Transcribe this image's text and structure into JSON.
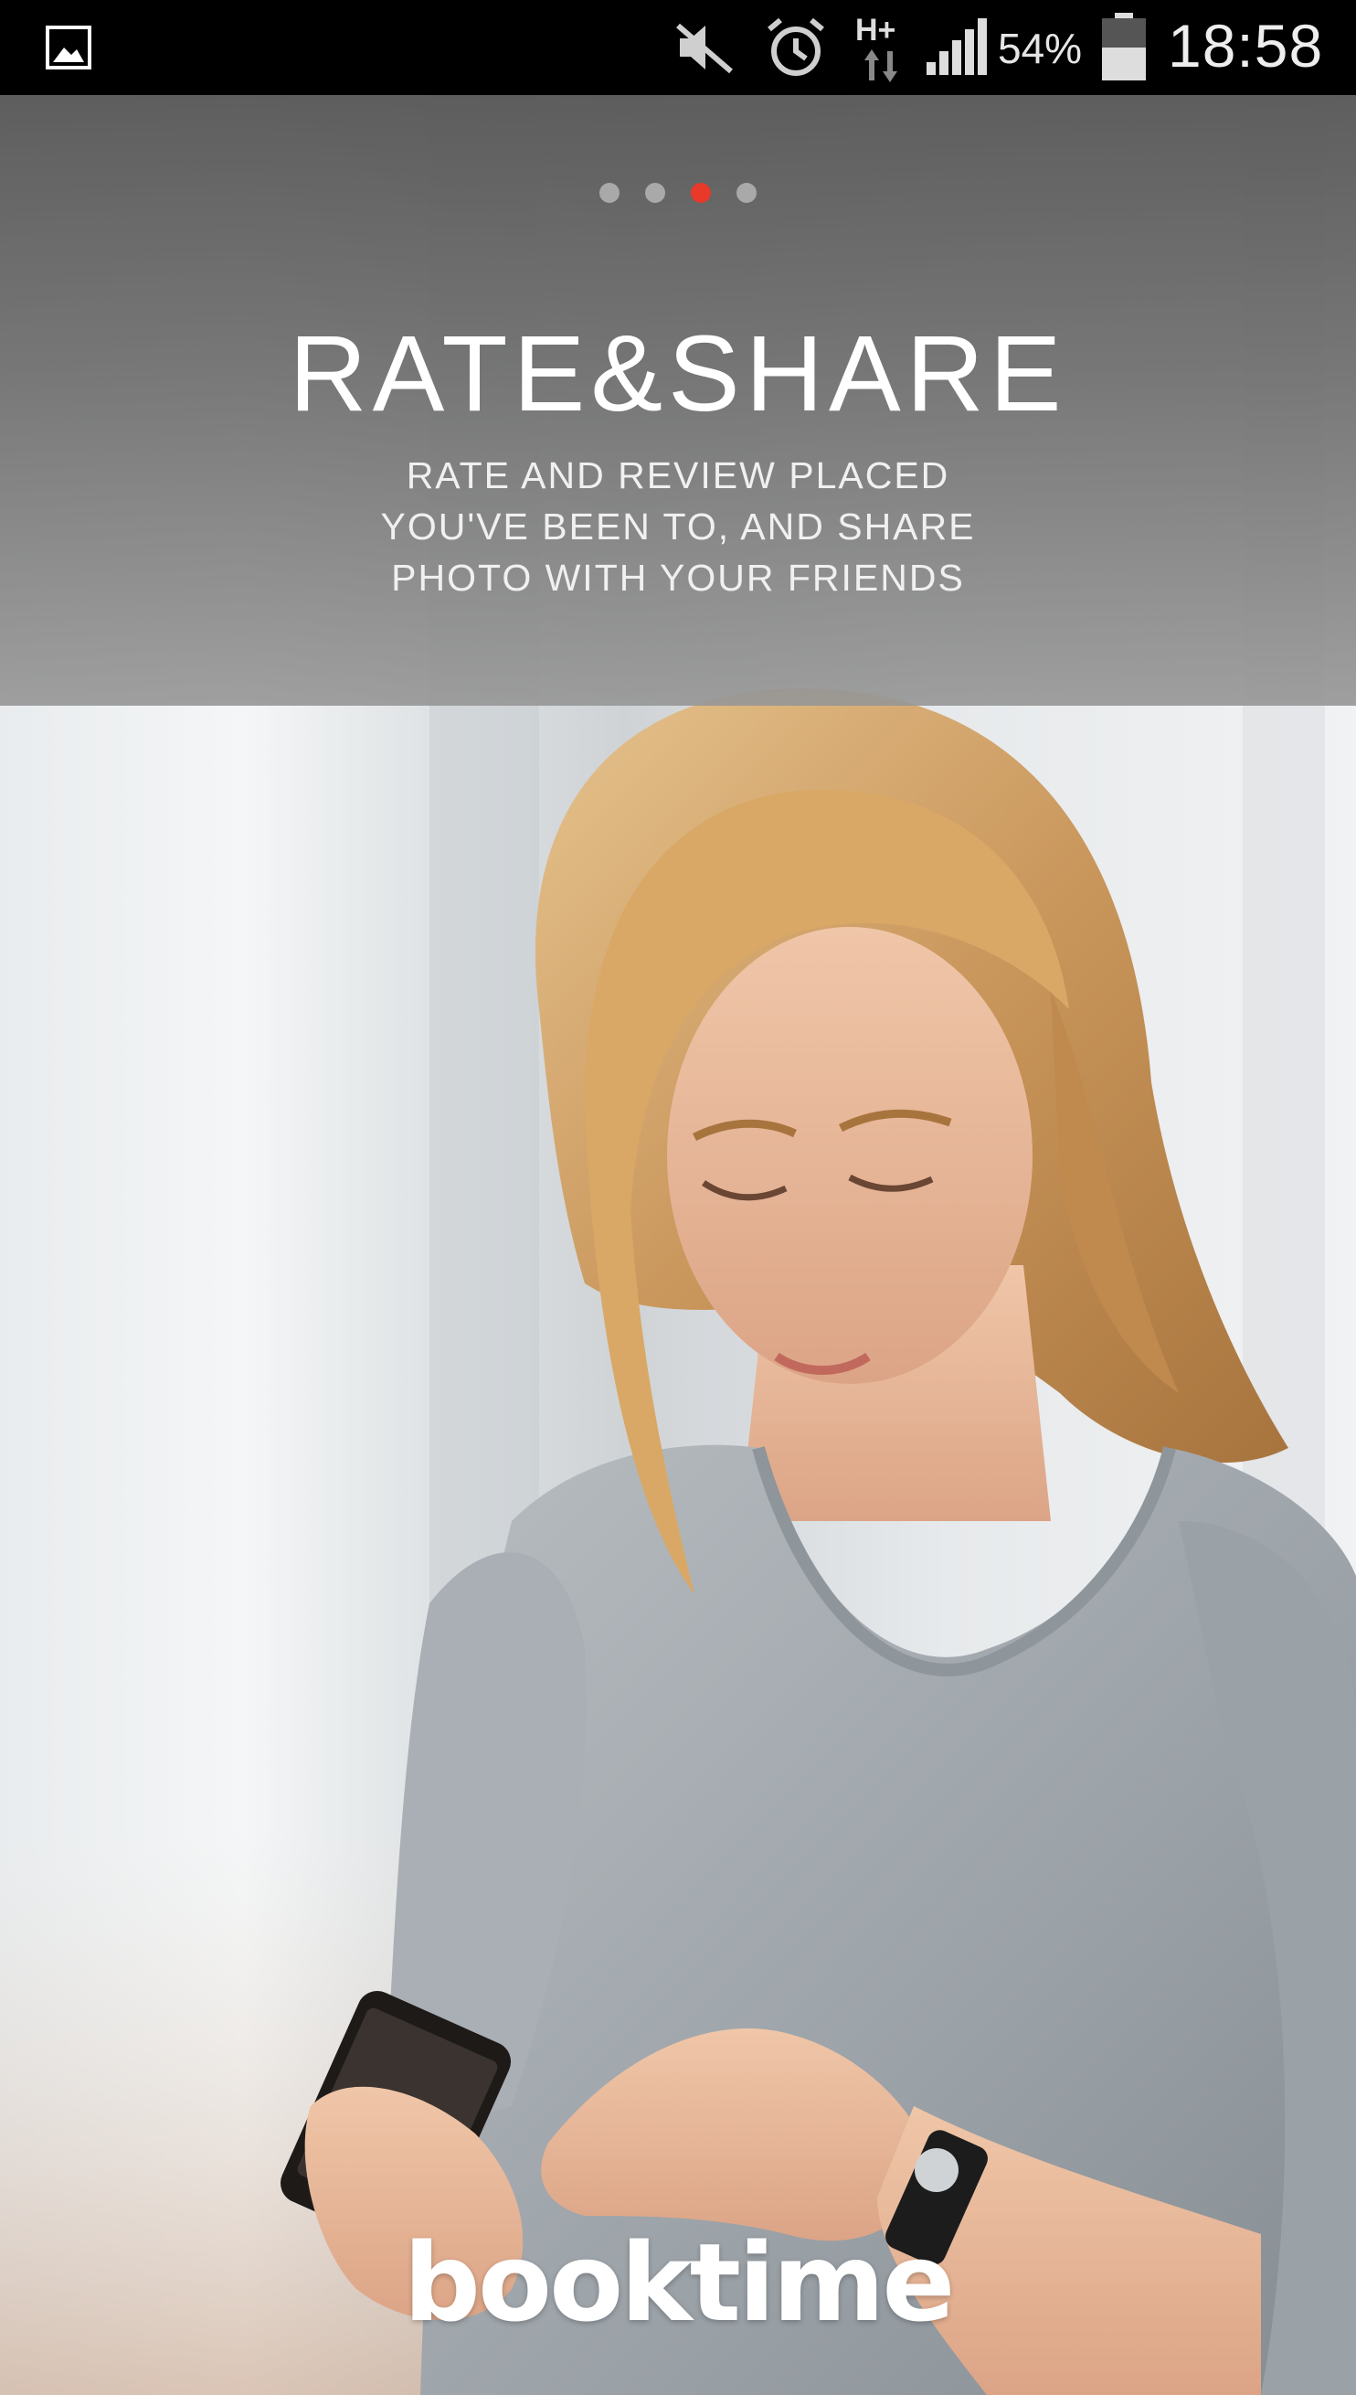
{
  "status_bar": {
    "network_type": "H+",
    "battery_percent": "54%",
    "time": "18:58",
    "icons": [
      "gallery-notification-icon",
      "mute-icon",
      "alarm-icon",
      "data-transfer-icon",
      "signal-icon",
      "battery-icon"
    ],
    "signal_level": 4,
    "battery_level": 0.54
  },
  "onboarding": {
    "pages_total": 4,
    "active_page_index": 2,
    "title": "RATE&SHARE",
    "subtitle_lines": [
      "RATE AND REVIEW PLACED",
      "YOU'VE BEEN TO, AND SHARE",
      "PHOTO WITH YOUR FRIENDS"
    ]
  },
  "brand": {
    "logo_text": "booktime"
  },
  "colors": {
    "active_dot": "#e8392a",
    "inactive_dot": "#a9a9a9",
    "overlay": "#6e6e6e"
  }
}
